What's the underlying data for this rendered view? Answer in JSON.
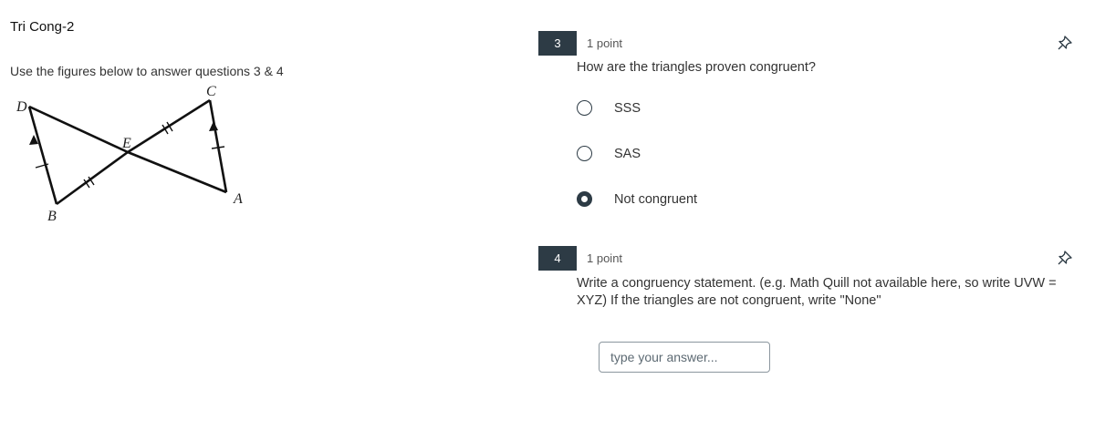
{
  "page": {
    "title": "Tri Cong-2"
  },
  "left": {
    "instructions": "Use the figures below to answer questions 3 & 4",
    "figure": {
      "labels": {
        "C": "C",
        "D": "D",
        "E": "E",
        "A": "A",
        "B": "B"
      }
    }
  },
  "questions": [
    {
      "number": "3",
      "points": "1 point",
      "prompt": "How are the triangles proven congruent?",
      "options": [
        {
          "label": "SSS",
          "selected": false
        },
        {
          "label": "SAS",
          "selected": false
        },
        {
          "label": "Not congruent",
          "selected": true
        }
      ],
      "pin_icon": "pin-icon"
    },
    {
      "number": "4",
      "points": "1 point",
      "prompt_line1": "Write a congruency statement. (e.g. Math Quill not available here, so write UVW =",
      "prompt_line2": "XYZ)  If the triangles are not congruent, write \"None\"",
      "answer": {
        "value": "",
        "placeholder": "type your answer..."
      },
      "pin_icon": "pin-icon"
    }
  ]
}
